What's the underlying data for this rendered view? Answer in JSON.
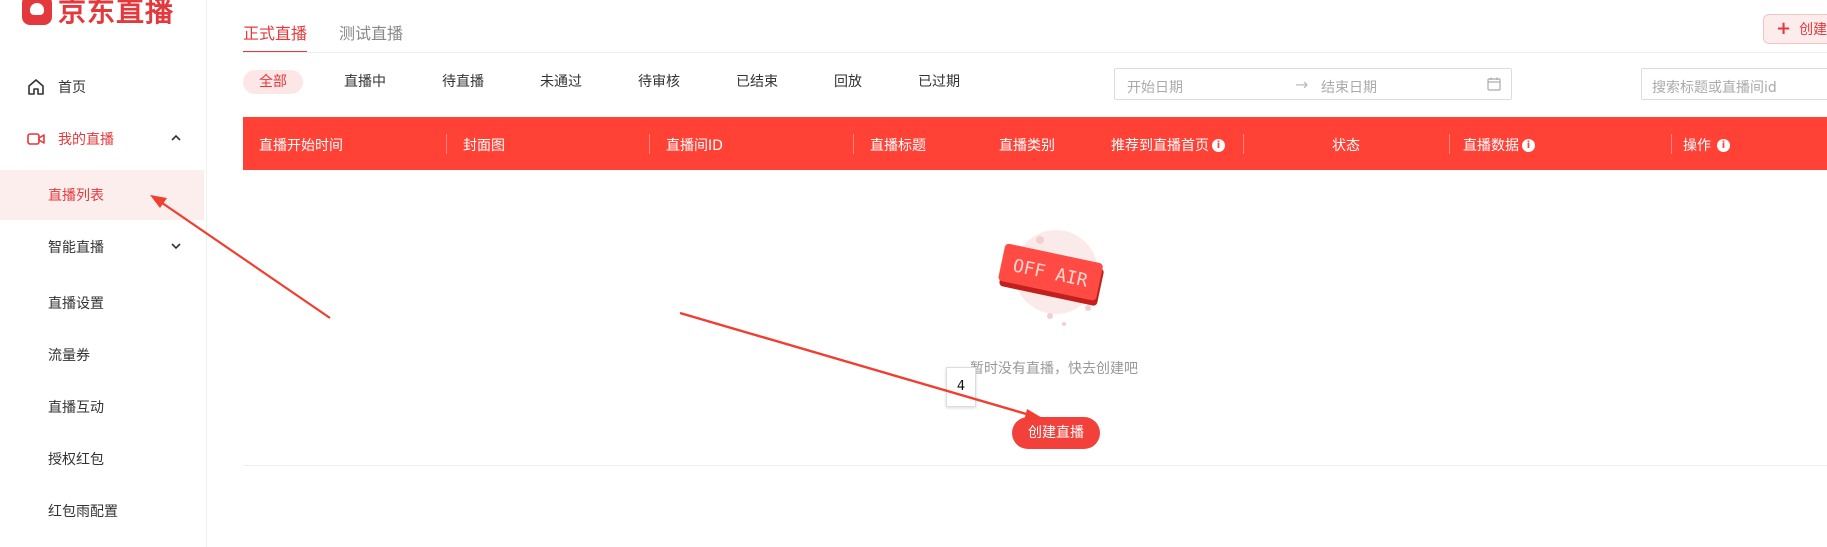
{
  "app": {
    "title": "京东直播"
  },
  "sidebar": {
    "items": [
      {
        "label": "首页",
        "icon": "home-icon"
      },
      {
        "label": "我的直播",
        "icon": "video-camera-icon"
      },
      {
        "label": "直播列表"
      },
      {
        "label": "智能直播"
      },
      {
        "label": "直播设置"
      },
      {
        "label": "流量券"
      },
      {
        "label": "直播互动"
      },
      {
        "label": "授权红包"
      },
      {
        "label": "红包雨配置"
      }
    ]
  },
  "header": {
    "tabs": [
      {
        "label": "正式直播",
        "active": true
      },
      {
        "label": "测试直播",
        "active": false
      }
    ],
    "create_button": "创建直"
  },
  "filters": {
    "status_tabs": [
      "全部",
      "直播中",
      "待直播",
      "未通过",
      "待审核",
      "已结束",
      "回放",
      "已过期"
    ],
    "active": "全部",
    "date_start_placeholder": "开始日期",
    "date_arrow": "→",
    "date_end_placeholder": "结束日期",
    "search_placeholder": "搜索标题或直播间id"
  },
  "table": {
    "columns": [
      "直播开始时间",
      "封面图",
      "直播间ID",
      "直播标题",
      "直播类别",
      "推荐到直播首页",
      "状态",
      "直播数据",
      "操作"
    ],
    "empty_text": "暂时没有直播，快去创建吧",
    "empty_illustration": "OFF AIR",
    "create_button": "创建直播"
  },
  "annotation": {
    "label": "4"
  },
  "colors": {
    "accent": "#e4393c",
    "header_bg": "#ff4136",
    "button_bg": "#f2413b"
  }
}
